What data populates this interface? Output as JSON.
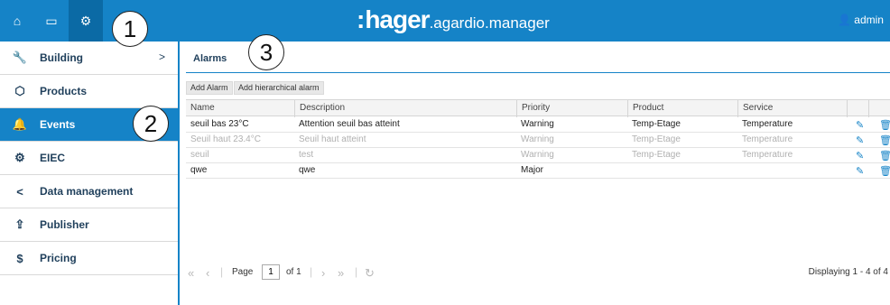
{
  "topbar": {
    "icons": [
      "home-icon",
      "laptop-icon",
      "gears-icon"
    ],
    "brand_colon": ":",
    "brand": "hager",
    "product": ".agardio.manager",
    "user": "admin"
  },
  "callouts": [
    "1",
    "2",
    "3"
  ],
  "sidebar": {
    "items": [
      {
        "label": "Building",
        "icon": "wrench-icon",
        "chevron": ">"
      },
      {
        "label": "Products",
        "icon": "cube-icon"
      },
      {
        "label": "Events",
        "icon": "bell-icon"
      },
      {
        "label": "EIEC",
        "icon": "gears-icon"
      },
      {
        "label": "Data management",
        "icon": "share-icon"
      },
      {
        "label": "Publisher",
        "icon": "upload-icon"
      },
      {
        "label": "Pricing",
        "icon": "dollar-icon"
      }
    ],
    "active_index": 2
  },
  "main": {
    "tab": "Alarms",
    "buttons": {
      "add_alarm": "Add Alarm",
      "add_hierarchical": "Add hierarchical alarm"
    },
    "columns": [
      "Name",
      "Description",
      "Priority",
      "Product",
      "Service"
    ],
    "rows": [
      [
        "seuil bas 23°C",
        "Attention seuil bas atteint",
        "Warning",
        "Temp-Etage",
        "Temperature"
      ],
      [
        "Seuil haut 23.4°C",
        "Seuil haut atteint",
        "Warning",
        "Temp-Etage",
        "Temperature"
      ],
      [
        "seuil",
        "test",
        "Warning",
        "Temp-Etage",
        "Temperature"
      ],
      [
        "qwe",
        "qwe",
        "Major",
        "",
        ""
      ]
    ]
  },
  "pager": {
    "page_label": "Page",
    "page_value": "1",
    "of_label": "of 1",
    "displaying": "Displaying 1 - 4 of 4"
  },
  "colors": {
    "accent": "#1583c7",
    "accent_dark": "#0b6aa5",
    "disabled_text": "#b0b0b0"
  }
}
